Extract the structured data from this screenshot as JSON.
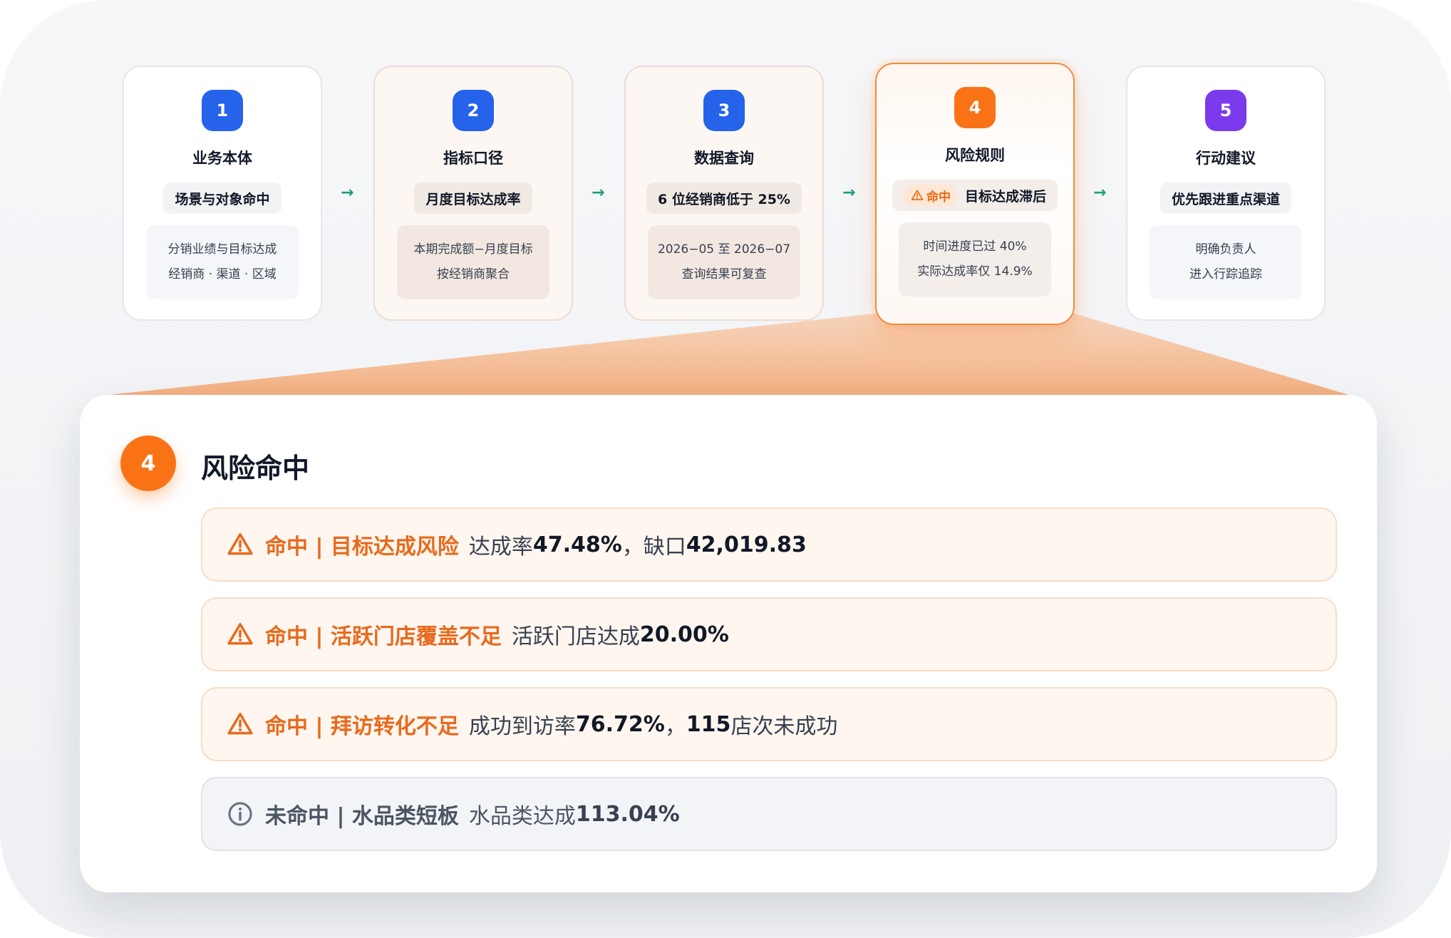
{
  "steps": [
    {
      "num": "1",
      "title": "业务本体",
      "tag": "场景与对象命中",
      "desc1": "分销业绩与目标达成",
      "desc2": "经销商 · 渠道 · 区域"
    },
    {
      "num": "2",
      "title": "指标口径",
      "tag": "月度目标达成率",
      "desc1": "本期完成额−月度目标",
      "desc2": "按经销商聚合"
    },
    {
      "num": "3",
      "title": "数据查询",
      "tag": "6 位经销商低于 25%",
      "desc1": "2026−05 至 2026−07",
      "desc2": "查询结果可复查"
    },
    {
      "num": "4",
      "title": "风险规则",
      "hit_chip": "命中",
      "tag": "目标达成滞后",
      "desc1": "时间进度已过 40%",
      "desc2": "实际达成率仅 14.9%"
    },
    {
      "num": "5",
      "title": "行动建议",
      "tag": "优先跟进重点渠道",
      "desc1": "明确负责人",
      "desc2": "进入行踪追踪"
    }
  ],
  "panel": {
    "num": "4",
    "title": "风险命中",
    "rules": [
      {
        "status": "hit",
        "icon": "warning-icon",
        "label": "命中 | 目标达成风险",
        "t1": "达成率 ",
        "v1": "47.48%",
        "t2": "，缺口 ",
        "v2": "42,019.83",
        "t3": ""
      },
      {
        "status": "hit",
        "icon": "warning-icon",
        "label": "命中 | 活跃门店覆盖不足",
        "t1": "活跃门店达成 ",
        "v1": "20.00%",
        "t2": "",
        "v2": "",
        "t3": ""
      },
      {
        "status": "hit",
        "icon": "warning-icon",
        "label": "命中 | 拜访转化不足",
        "t1": "成功到访率 ",
        "v1": "76.72%",
        "t2": "，",
        "v2": "115",
        "t3": " 店次未成功"
      },
      {
        "status": "miss",
        "icon": "info-icon",
        "label": "未命中 | 水品类短板",
        "t1": "水品类达成 ",
        "v1": "113.04%",
        "t2": "",
        "v2": "",
        "t3": ""
      }
    ]
  },
  "colors": {
    "blue": "#2563eb",
    "orange": "#f97316",
    "purple": "#7c3aed",
    "arrow": "#1f9d7a",
    "hit_text": "#e8691c"
  }
}
